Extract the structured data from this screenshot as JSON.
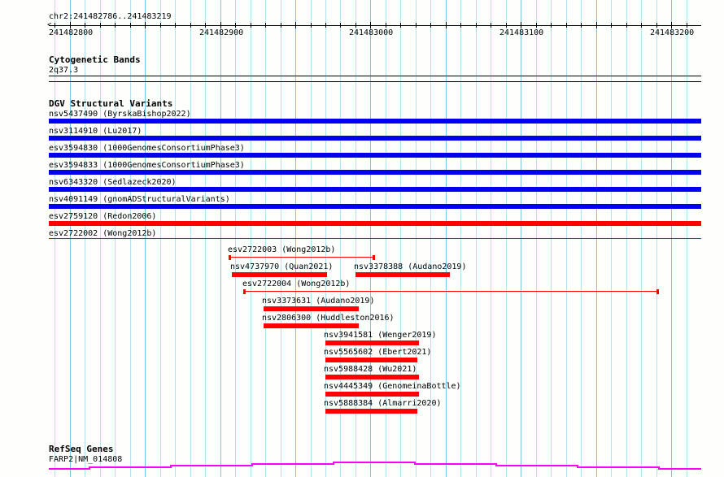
{
  "ruler": {
    "location": "chr2:241482786..241483219",
    "start": 241482786,
    "end": 241483219,
    "labels": [
      "241482800",
      "241482900",
      "241483000",
      "241483100",
      "241483200"
    ]
  },
  "cytoband": {
    "title": "Cytogenetic Bands",
    "band": "2q37.3"
  },
  "dgv": {
    "title": "DGV Structural Variants",
    "full_rows": [
      {
        "label": "nsv5437490 (ByrskaBishop2022)",
        "color": "#0000ee",
        "style": "bar"
      },
      {
        "label": "nsv3114910 (Lu2017)",
        "color": "#0000ee",
        "style": "bar"
      },
      {
        "label": "esv3594830 (1000GenomesConsortiumPhase3)",
        "color": "#0000ee",
        "style": "bar"
      },
      {
        "label": "esv3594833 (1000GenomesConsortiumPhase3)",
        "color": "#0000ee",
        "style": "bar"
      },
      {
        "label": "nsv6343320 (Sedlazeck2020)",
        "color": "#0000ee",
        "style": "bar"
      },
      {
        "label": "nsv4091149 (gnomADStructuralVariants)",
        "color": "#0000ee",
        "style": "bar"
      },
      {
        "label": "esv2759120 (Redon2006)",
        "color": "#ff0000",
        "style": "bar"
      },
      {
        "label": "esv2722002 (Wong2012b)",
        "color": "#ff0000",
        "style": "line"
      }
    ],
    "features": [
      {
        "label": "esv2722003 (Wong2012b)",
        "start": 241482906,
        "end": 241483002,
        "style": "line",
        "row": 0
      },
      {
        "label": "nsv4737970 (Quan2021)",
        "start": 241482908,
        "end": 241482971,
        "style": "bar",
        "row": 1
      },
      {
        "label": "nsv3378388 (Audano2019)",
        "start": 241482990,
        "end": 241483053,
        "style": "bar",
        "row": 1
      },
      {
        "label": "esv2722004 (Wong2012b)",
        "start": 241482916,
        "end": 241483191,
        "style": "line",
        "row": 2
      },
      {
        "label": "nsv3373631 (Audano2019)",
        "start": 241482929,
        "end": 241482992,
        "style": "bar",
        "row": 3
      },
      {
        "label": "nsv2806300 (Huddleston2016)",
        "start": 241482929,
        "end": 241482992,
        "style": "bar",
        "row": 4
      },
      {
        "label": "nsv3941581 (Wenger2019)",
        "start": 241482970,
        "end": 241483032,
        "style": "bar",
        "row": 5
      },
      {
        "label": "nsv5565602 (Ebert2021)",
        "start": 241482970,
        "end": 241483031,
        "style": "bar",
        "row": 6
      },
      {
        "label": "nsv5988428 (Wu2021)",
        "start": 241482970,
        "end": 241483032,
        "style": "bar",
        "row": 7
      },
      {
        "label": "nsv4445349 (GenomeinaBottle)",
        "start": 241482970,
        "end": 241483032,
        "style": "bar",
        "row": 8
      },
      {
        "label": "nsv5888384 (Almarri2020)",
        "start": 241482970,
        "end": 241483031,
        "style": "bar",
        "row": 9
      }
    ]
  },
  "refseq": {
    "title": "RefSeq Genes",
    "gene": "FARP2|NM_014808",
    "color": "#ff00ff"
  }
}
